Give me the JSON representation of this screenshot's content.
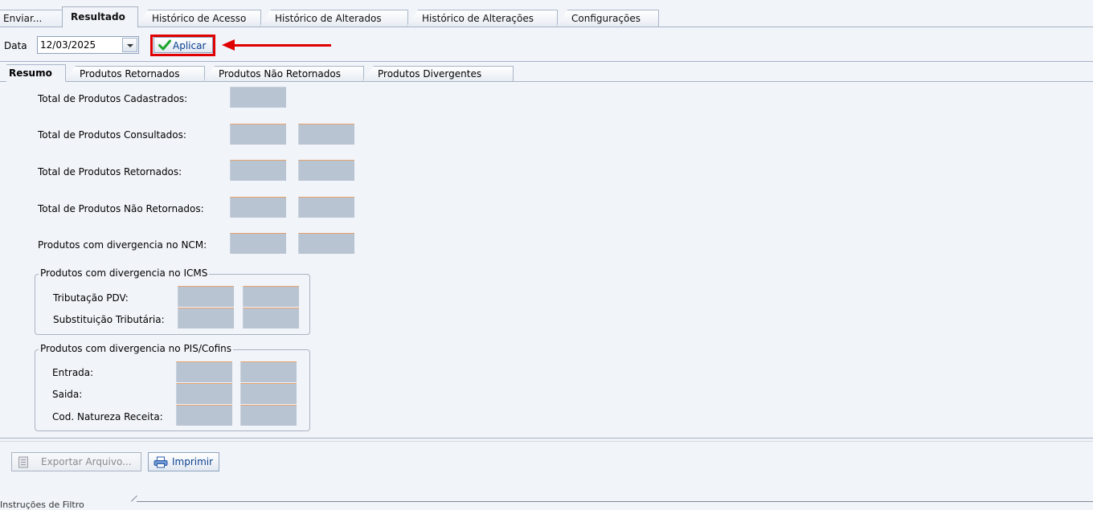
{
  "top_tabs": [
    {
      "label": "Enviar..."
    },
    {
      "label": "Resultado",
      "active": true
    },
    {
      "label": "Histórico de Acesso"
    },
    {
      "label": "Histórico de Alterados"
    },
    {
      "label": "Histórico de Alterações"
    },
    {
      "label": "Configurações"
    }
  ],
  "date": {
    "label": "Data",
    "value": "12/03/2025",
    "dropdown_icon": "chevron-down-icon"
  },
  "apply": {
    "label": "Aplicar",
    "icon": "check-icon",
    "highlight_color": "#e00000"
  },
  "sub_tabs": [
    {
      "label": "Resumo",
      "active": true
    },
    {
      "label": "Produtos Retornados"
    },
    {
      "label": "Produtos Não Retornados"
    },
    {
      "label": "Produtos Divergentes"
    }
  ],
  "summary": {
    "cadastrados": "Total de Produtos Cadastrados:",
    "consultados": "Total de Produtos Consultados:",
    "retornados": "Total de Produtos Retornados:",
    "nao_retornados": "Total de Produtos Não Retornados:",
    "ncm": "Produtos com divergencia no NCM:"
  },
  "icms_group": {
    "title": "Produtos com divergencia no ICMS",
    "rows": [
      "Tributação PDV:",
      "Substituição Tributária:"
    ]
  },
  "pis_group": {
    "title": "Produtos com divergencia no PIS/Cofins",
    "rows": [
      "Entrada:",
      "Saida:",
      "Cod. Natureza Receita:"
    ]
  },
  "actions": {
    "export_label": "Exportar Arquivo...",
    "export_icon": "document-icon",
    "print_label": "Imprimir",
    "print_icon": "printer-icon"
  },
  "bottom_tab": {
    "label": "Instruções de Filtro"
  },
  "colors": {
    "background": "#f1f4f9",
    "field_fill": "#b9c4d2",
    "field_top_border": "#e8a36c",
    "link_blue": "#0b3f8f"
  }
}
